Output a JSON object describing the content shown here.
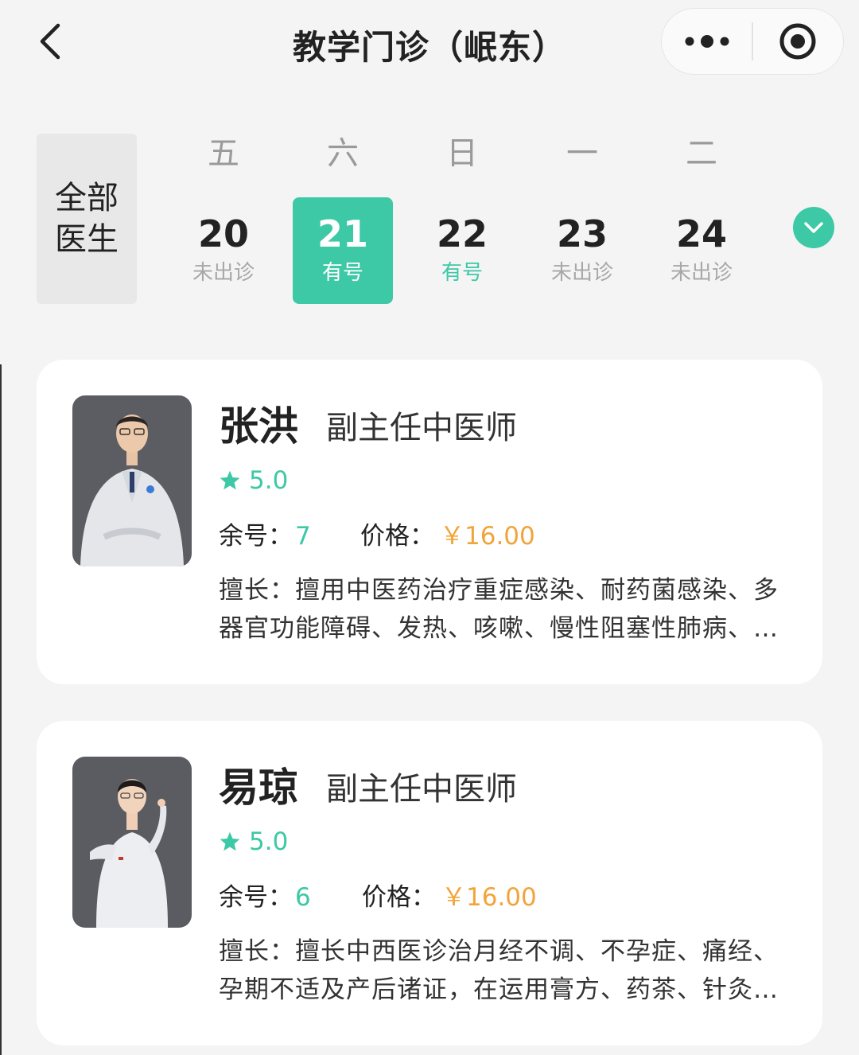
{
  "nav": {
    "title": "教学门诊（岷东）",
    "back_icon": "chevron-left-icon",
    "more_icon": "more-dots-icon",
    "close_icon": "target-circle-icon"
  },
  "date_bar": {
    "all_doctors_line1": "全部",
    "all_doctors_line2": "医生",
    "days": [
      {
        "weekday": "五",
        "date": "20",
        "status": "未出诊",
        "available": false,
        "selected": false
      },
      {
        "weekday": "六",
        "date": "21",
        "status": "有号",
        "available": true,
        "selected": true
      },
      {
        "weekday": "日",
        "date": "22",
        "status": "有号",
        "available": true,
        "selected": false
      },
      {
        "weekday": "一",
        "date": "23",
        "status": "未出诊",
        "available": false,
        "selected": false
      },
      {
        "weekday": "二",
        "date": "24",
        "status": "未出诊",
        "available": false,
        "selected": false
      }
    ],
    "expand_icon": "chevron-down-icon"
  },
  "doctors": [
    {
      "name": "张洪",
      "title": "副主任中医师",
      "rating": "5.0",
      "remaining_label": "余号：",
      "remaining": "7",
      "price_label": "价格：",
      "price": "￥16.00",
      "specialty_line1": "擅长：擅用中医药治疗重症感染、耐药菌感染、多",
      "specialty_line2": "器官功能障碍、发热、咳嗽、慢性阻塞性肺病、…"
    },
    {
      "name": "易琼",
      "title": "副主任中医师",
      "rating": "5.0",
      "remaining_label": "余号：",
      "remaining": "6",
      "price_label": "价格：",
      "price": "￥16.00",
      "specialty_line1": "擅长：擅长中西医诊治月经不调、不孕症、痛经、",
      "specialty_line2": "孕期不适及产后诸证，在运用膏方、药茶、针灸…"
    }
  ],
  "colors": {
    "accent": "#3dc8a6",
    "price": "#f2a43c",
    "background": "#f4f4f4"
  }
}
